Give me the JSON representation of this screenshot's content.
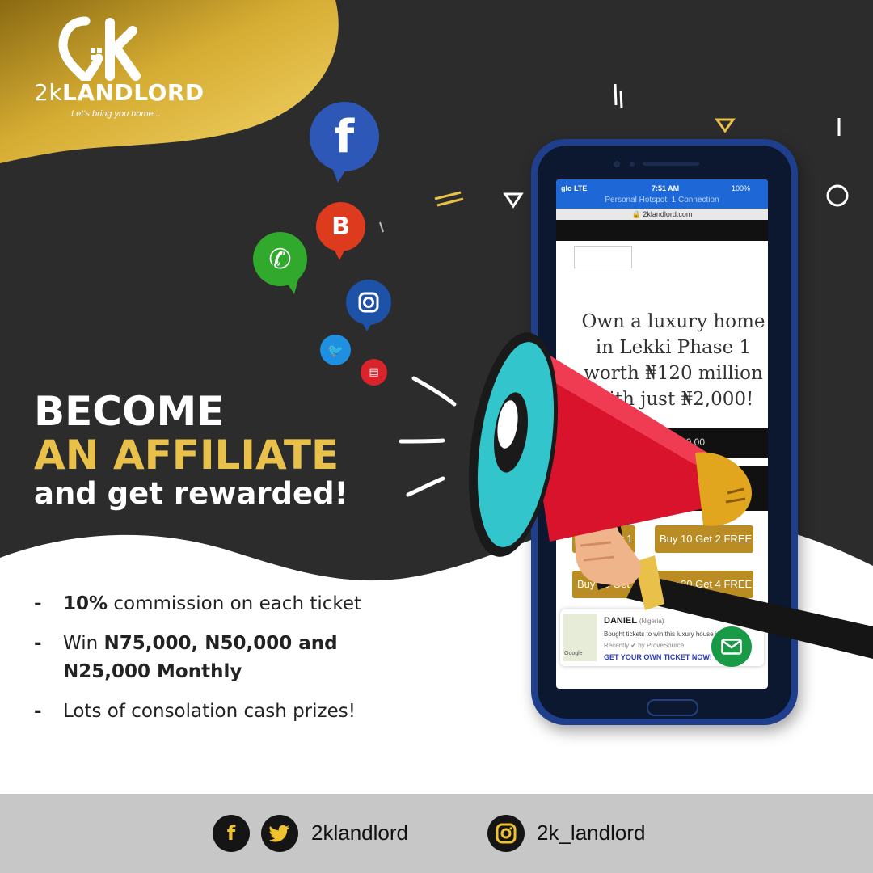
{
  "brand": {
    "logo_mark": "2k",
    "name_prefix": "2k",
    "name_main": "LANDLORD",
    "tagline": "Let's bring you home..."
  },
  "headline": {
    "line1": "BECOME",
    "line2": "AN AFFILIATE",
    "line3": "and get rewarded!"
  },
  "bullets": [
    {
      "dash": "-",
      "bold": "10%",
      "text": " commission on each ticket"
    },
    {
      "dash": "-",
      "bold_pre": "Win ",
      "bold": "N75,000, N50,000 and N25,000 Monthly"
    },
    {
      "dash": "-",
      "text": "Lots of consolation cash prizes!"
    }
  ],
  "phone": {
    "carrier": "glo  LTE",
    "time": "7:51 AM",
    "battery": "100%",
    "hotspot": "Personal Hotspot: 1 Connection",
    "url": "🔒 2klandlord.com",
    "promo": "Own a luxury home in Lekki Phase 1 worth ₦120 million with just ₦2,000!",
    "price_fragment": "0.00",
    "buttons": [
      "Buy 5 Get 1 FREE",
      "Buy 10 Get 2 FREE",
      "Buy 15 Get 3 FREE",
      "Buy 20 Get 4 FREE"
    ],
    "notification": {
      "name": "DANIEL",
      "country": "(Nigeria)",
      "desc": "Bought tickets to win this luxury house in",
      "via": "Recently ✔ by ProveSource",
      "cta": "GET YOUR OWN TICKET NOW! ›",
      "map_label": "Google"
    }
  },
  "footer": {
    "handle_1": "2klandlord",
    "handle_2": "2k_landlord"
  },
  "icons": {
    "facebook_glyph": "f",
    "blogger_glyph": "B",
    "whatsapp_glyph": "✆",
    "twitter_glyph": "🐦"
  },
  "colors": {
    "background": "#2c2c2c",
    "gold": "#e9c14a",
    "phone_blue": "#1f3f8c",
    "footer": "#c7c7c7"
  }
}
